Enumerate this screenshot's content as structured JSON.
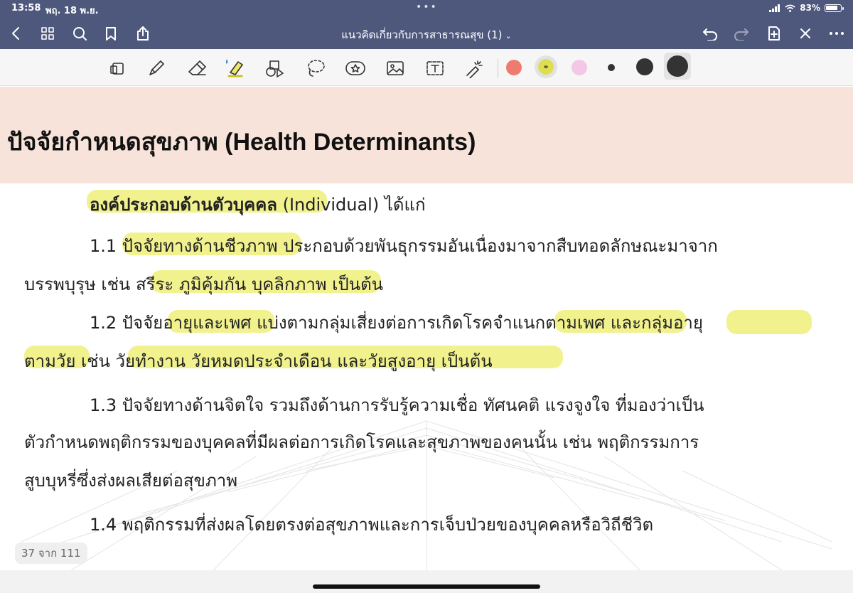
{
  "status": {
    "time": "13:58",
    "date": "พฤ. 18 พ.ย.",
    "battery": "83%"
  },
  "nav": {
    "title": "แนวคิดเกี่ยวกับการสาธารณสุข (1)",
    "icons": [
      "back-icon",
      "grid-icon",
      "search-icon",
      "bookmark-icon",
      "share-icon",
      "undo-icon",
      "redo-icon",
      "add-page-icon",
      "close-icon",
      "more-icon"
    ]
  },
  "toolbar": {
    "tools": [
      "reading-mode-icon",
      "pen-icon",
      "eraser-icon",
      "highlighter-icon",
      "shapes-icon",
      "lasso-icon",
      "sticker-icon",
      "image-icon",
      "text-icon",
      "laser-icon"
    ],
    "colors": {
      "red": "#ee7b6f",
      "yellow": "#dede52",
      "pink": "#f3c7e6",
      "black": "#333333"
    }
  },
  "document": {
    "heading_thai": "ปัจจัยกำหนดสุขภาพ",
    "heading_en": " (Health Determinants)",
    "line1_bold": "องค์ประกอบด้านตัวบุคคล",
    "line1_rest": " (Individual) ได้แก่",
    "p11a": "1.1 ปัจจัยทางด้านชีวภาพ ประกอบด้วยพันธุกรรมอันเนื่องมาจากสืบทอดลักษณะมาจาก",
    "p11b": "บรรพบุรุษ เช่น สรีระ ภูมิคุ้มกัน บุคลิกภาพ เป็นต้น",
    "p12a": "1.2 ปัจจัยอายุและเพศ แบ่งตามกลุ่มเสี่ยงต่อการเกิดโรคจำแนกตามเพศ และกลุ่มอายุ",
    "p12b": "ตามวัย เช่น วัยทำงาน วัยหมดประจำเดือน และวัยสูงอายุ เป็นต้น",
    "p13a": "1.3 ปัจจัยทางด้านจิตใจ รวมถึงด้านการรับรู้ความเชื่อ ทัศนคติ แรงจูงใจ ที่มองว่าเป็น",
    "p13b": "ตัวกำหนดพฤติกรรมของบุคคลที่มีผลต่อการเกิดโรคและสุขภาพของคนนั้น เช่น พฤติกรรมการ",
    "p13c": "สูบบุหรี่ซึ่งส่งผลเสียต่อสุขภาพ",
    "p14": "1.4 พฤติกรรมที่ส่งผลโดยตรงต่อสุขภาพและการเจ็บป่วยของบุคคลหรือวิถีชีวิต"
  },
  "page_counter": "37 จาก 111"
}
